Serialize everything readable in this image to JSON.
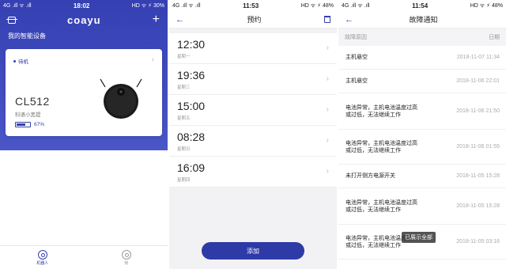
{
  "screen1": {
    "status": {
      "left": "4G .ıll  ᯤ .ıll",
      "time": "18:02",
      "right": "HD ᯤ ⚡ 30%"
    },
    "brand": "coayu",
    "title": "我的智能设备",
    "device": {
      "status": "待机",
      "model": "CL512",
      "name": "科语小黑提",
      "battery": "67%",
      "battery_level": 0.67
    },
    "tabs": [
      {
        "label": "机器人",
        "active": true
      },
      {
        "label": "我",
        "active": false
      }
    ]
  },
  "screen2": {
    "status": {
      "left": "4G .ıll  ᯤ .ıll",
      "time": "11:53",
      "right": "HD ᯤ ⚡ 48%"
    },
    "title": "预约",
    "schedules": [
      {
        "time": "12:30",
        "day": "星期一"
      },
      {
        "time": "19:36",
        "day": "星期三"
      },
      {
        "time": "15:00",
        "day": "星期五"
      },
      {
        "time": "08:28",
        "day": "星期日"
      },
      {
        "time": "16:09",
        "day": "星期四"
      }
    ],
    "add_label": "添加"
  },
  "screen3": {
    "status": {
      "left": "4G .ıll  ᯤ .ıll",
      "time": "11:54",
      "right": "HD ᯤ ⚡ 48%"
    },
    "title": "故障通知",
    "col_reason": "故障原因",
    "col_date": "日期",
    "faults": [
      {
        "reason": "主机悬空",
        "time": "2018-11-07 11:34"
      },
      {
        "reason": "主机悬空",
        "time": "2018-11-06 22:01"
      },
      {
        "reason": "电池异常，主机电池温度过高或过低，无法继续工作",
        "time": "2018-11-06 21:50"
      },
      {
        "reason": "电池异常，主机电池温度过高或过低，无法继续工作",
        "time": "2018-11-06 01:55"
      },
      {
        "reason": "未打开侧方电源开关",
        "time": "2018-11-05 15:28"
      },
      {
        "reason": "电池异常，主机电池温度过高或过低，无法继续工作",
        "time": "2018-11-05 15:28"
      },
      {
        "reason": "电池异常，主机电池温度过高或过低，无法继续工作",
        "time": "2018-11-05 03:16"
      }
    ],
    "toast": "已展示全部"
  },
  "colors": {
    "primary": "#3340b0",
    "header_gradient_top": "#3540b3"
  }
}
